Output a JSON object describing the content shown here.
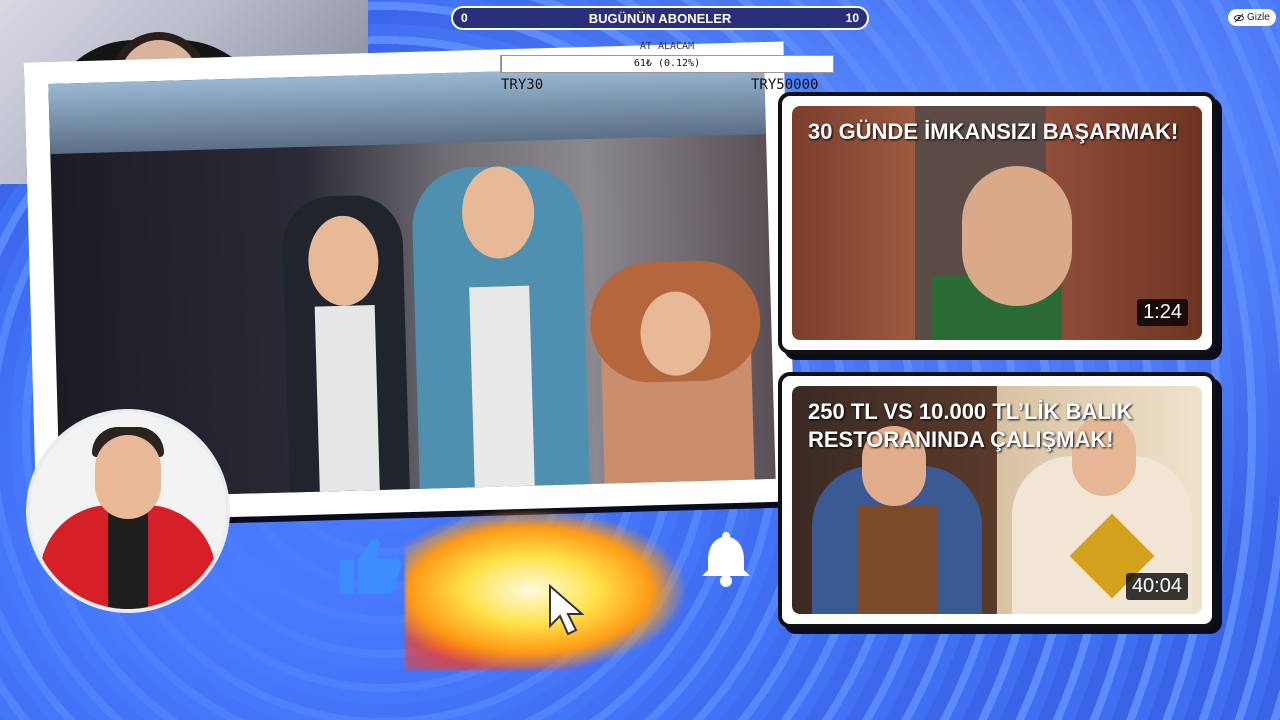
{
  "subscriber_goal": {
    "title": "BUGÜNÜN ABONELER",
    "current": "0",
    "target": "10"
  },
  "hide_button": {
    "label": "Gizle",
    "icon": "eye-slash-icon"
  },
  "donation_goal": {
    "label": "AT ALACAM",
    "progress_text": "61₺ (0.12%)",
    "progress_fraction": 0.0012,
    "min_label": "TRY30",
    "max_label": "TRY50000"
  },
  "social_icons": [
    "like-icon",
    "bell-icon"
  ],
  "video_cards": [
    {
      "title": "30 GÜNDE İMKANSIZI BAŞARMAK!",
      "duration": "1:24"
    },
    {
      "title": "250 TL VS 10.000 TL’LİK BALIK RESTORANINDA ÇALIŞMAK!",
      "duration": "40:04"
    }
  ],
  "colors": {
    "background": "#3a66ee",
    "goal_bar": "#2a2f7a",
    "donation_fill": "#2ecc71",
    "jacket_red": "#d61f26"
  }
}
